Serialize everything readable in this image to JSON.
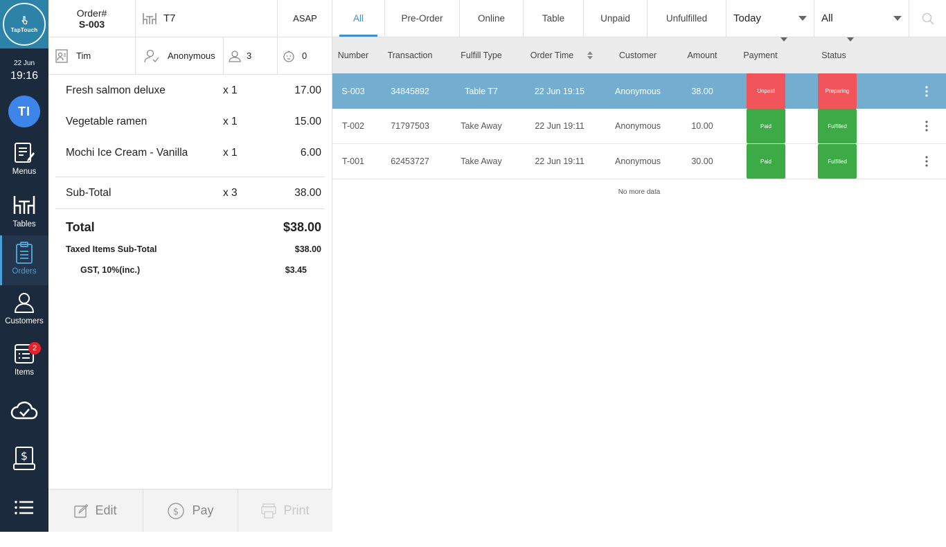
{
  "sidebar": {
    "logo_text": "TapTouch",
    "date": "22 Jun",
    "time": "19:16",
    "user_initials": "TI",
    "nav": [
      {
        "label": "Menus",
        "icon": "menu-edit-icon"
      },
      {
        "label": "Tables",
        "icon": "tables-icon"
      },
      {
        "label": "Orders",
        "icon": "orders-clipboard-icon",
        "active": true
      },
      {
        "label": "Customers",
        "icon": "customer-icon"
      },
      {
        "label": "Items",
        "icon": "items-list-icon",
        "badge": "2"
      },
      {
        "label": "",
        "icon": "cloud-sync-icon"
      },
      {
        "label": "",
        "icon": "cash-register-icon"
      },
      {
        "label": "",
        "icon": "more-list-icon"
      }
    ]
  },
  "order": {
    "order_label": "Order#",
    "order_number": "S-003",
    "table": "T7",
    "timing": "ASAP",
    "staff": "Tim",
    "customer": "Anonymous",
    "guests": "3",
    "kids": "0",
    "items": [
      {
        "name": "Fresh salmon deluxe",
        "qty": "x 1",
        "price": "17.00"
      },
      {
        "name": "Vegetable ramen",
        "qty": "x 1",
        "price": "15.00"
      },
      {
        "name": "Mochi Ice Cream - Vanilla",
        "qty": "x 1",
        "price": "6.00"
      }
    ],
    "subtotal": {
      "label": "Sub-Total",
      "qty": "x 3",
      "amount": "38.00"
    },
    "total": {
      "label": "Total",
      "amount": "$38.00"
    },
    "taxed": {
      "label": "Taxed Items Sub-Total",
      "amount": "$38.00"
    },
    "gst": {
      "label": "GST, 10%(inc.)",
      "amount": "$3.45"
    },
    "actions": {
      "edit": "Edit",
      "pay": "Pay",
      "print": "Print"
    }
  },
  "filters": {
    "tabs": [
      "All",
      "Pre-Order",
      "Online",
      "Table",
      "Unpaid",
      "Unfulfilled"
    ],
    "active_tab": "All",
    "date_select": "Today",
    "type_select": "All"
  },
  "table": {
    "headers": {
      "number": "Number",
      "transaction": "Transaction",
      "fulfill": "Fulfill Type",
      "time": "Order Time",
      "customer": "Customer",
      "amount": "Amount",
      "payment": "Payment",
      "status": "Status"
    },
    "rows": [
      {
        "number": "S-003",
        "transaction": "34845892",
        "fulfill": "Table T7",
        "time": "22 Jun 19:15",
        "customer": "Anonymous",
        "amount": "38.00",
        "payment": "Unpaid",
        "status": "Preparing"
      },
      {
        "number": "T-002",
        "transaction": "71797503",
        "fulfill": "Take Away",
        "time": "22 Jun 19:11",
        "customer": "Anonymous",
        "amount": "10.00",
        "payment": "Paid",
        "status": "Fulfilled"
      },
      {
        "number": "T-001",
        "transaction": "62453727",
        "fulfill": "Take Away",
        "time": "22 Jun 19:11",
        "customer": "Anonymous",
        "amount": "30.00",
        "payment": "Paid",
        "status": "Fulfilled"
      }
    ],
    "end_text": "No more data"
  },
  "colors": {
    "sidebar_bg": "#1b2a3d",
    "accent": "#3b8fd4",
    "selected_row": "#73aed0",
    "unpaid_red": "#f2545b",
    "paid_green": "#3dab45",
    "badge_red": "#e8212b"
  }
}
